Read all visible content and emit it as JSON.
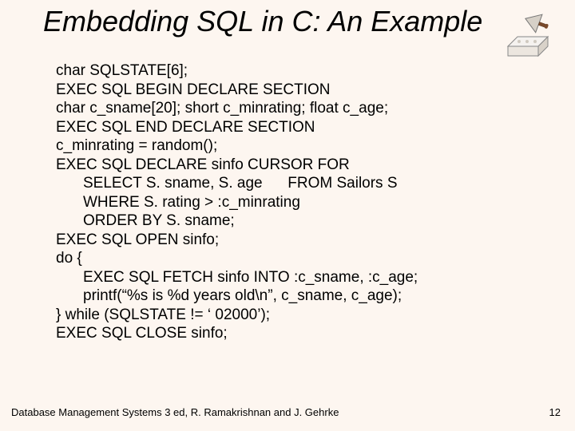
{
  "title": "Embedding SQL in C: An Example",
  "code": {
    "l1": "char SQLSTATE[6];",
    "l2": "EXEC SQL BEGIN DECLARE SECTION",
    "l3": "char c_sname[20]; short c_minrating; float c_age;",
    "l4": "EXEC SQL END DECLARE SECTION",
    "l5": "c_minrating = random();",
    "l6": "EXEC SQL DECLARE sinfo CURSOR FOR",
    "l7": "SELECT S. sname, S. age      FROM Sailors S",
    "l8": "WHERE S. rating > :c_minrating",
    "l9": "ORDER BY S. sname;",
    "l10": "EXEC SQL OPEN sinfo;",
    "l11": "do {",
    "l12": "EXEC SQL FETCH sinfo INTO :c_sname, :c_age;",
    "l13": "printf(“%s is %d years old\\n”, c_sname, c_age);",
    "l14": "} while (SQLSTATE != ‘ 02000’);",
    "l15": "EXEC SQL CLOSE sinfo;"
  },
  "footer": "Database Management Systems 3 ed,  R. Ramakrishnan and J. Gehrke",
  "pagenum": "12"
}
